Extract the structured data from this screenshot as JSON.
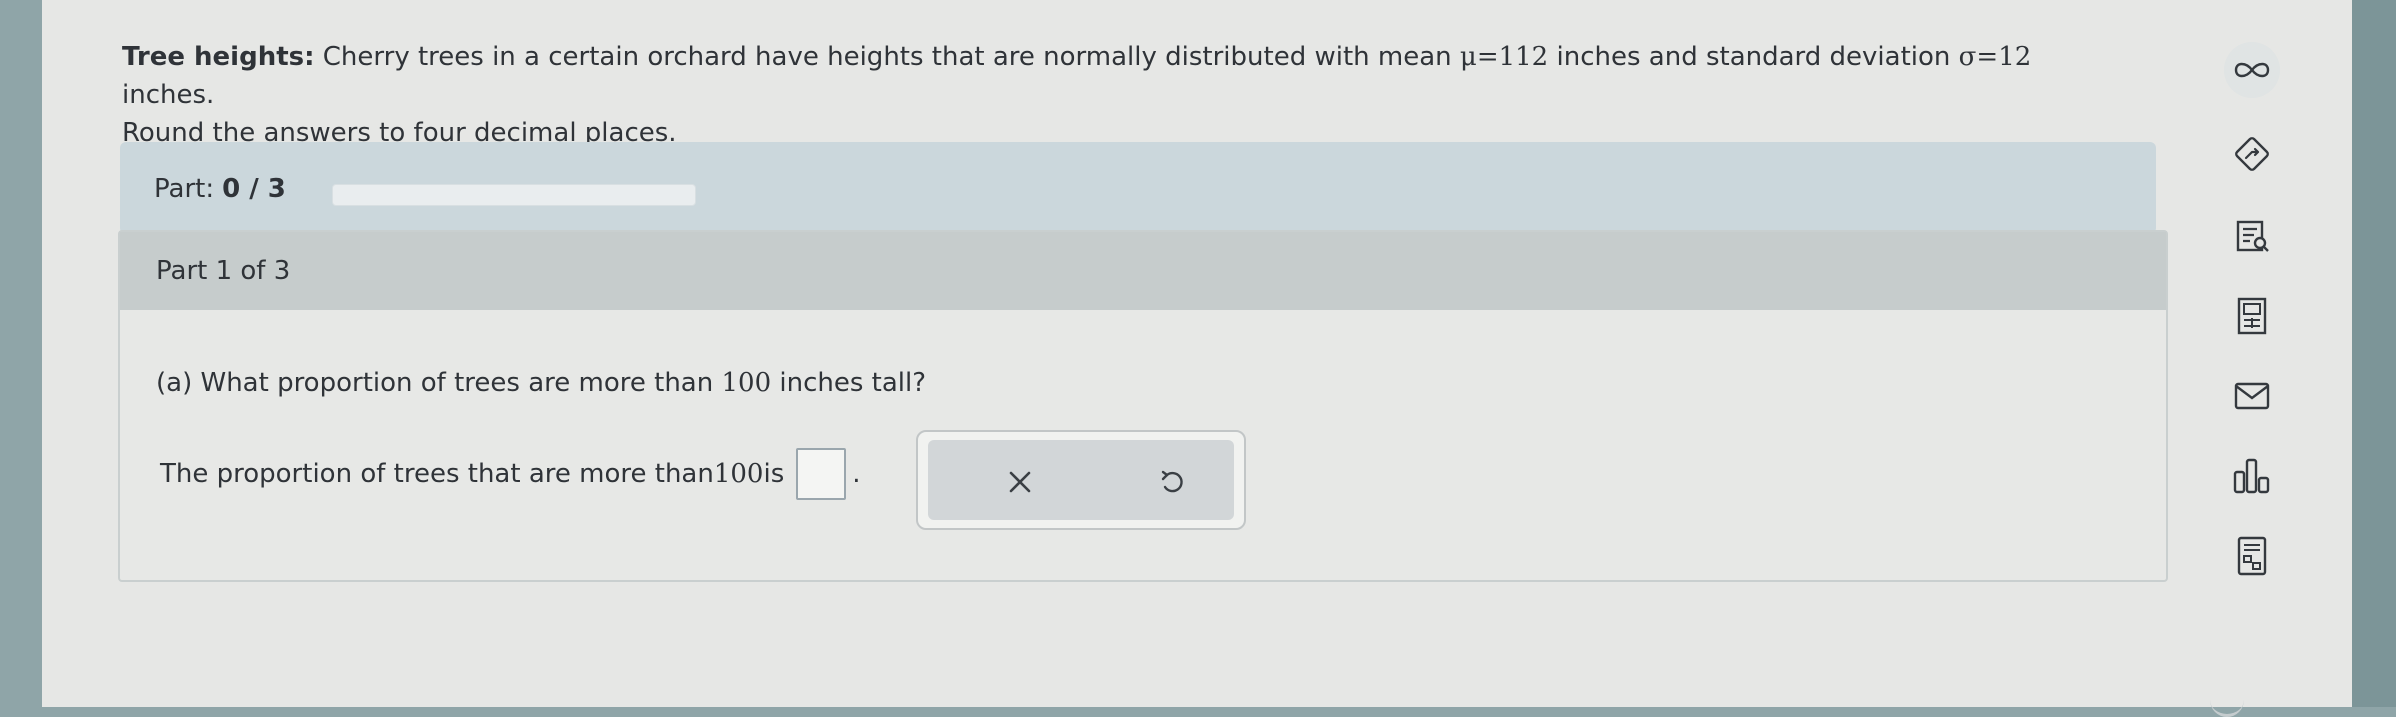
{
  "problem": {
    "title": "Tree heights:",
    "text_part1": "Cherry trees in a certain orchard have heights that are normally distributed with mean ",
    "mu_symbol": "μ",
    "mu_value": "=112",
    "text_part2": " inches and standard deviation ",
    "sigma_symbol": "σ",
    "sigma_value": "=12",
    "text_part3": " inches.",
    "instruction": "Round the answers to four decimal places."
  },
  "progress": {
    "label": "Part:",
    "value": "0 / 3",
    "fraction": 0
  },
  "part": {
    "header": "Part 1 of 3",
    "question_prefix": "(a) What proportion of trees are more than ",
    "question_number": "100",
    "question_suffix": " inches tall?",
    "answer_prefix": "The proportion of trees that are more than ",
    "answer_number": "100",
    "answer_is": " is",
    "answer_value": "",
    "answer_period": "."
  },
  "actions": {
    "clear_icon": "x-icon",
    "undo_icon": "undo-icon"
  },
  "side_tools": [
    {
      "icon": "infinity-icon"
    },
    {
      "icon": "compass-icon"
    },
    {
      "icon": "lookup-icon"
    },
    {
      "icon": "calculator-icon"
    },
    {
      "icon": "mail-icon"
    },
    {
      "icon": "bar-chart-icon"
    },
    {
      "icon": "data-table-icon"
    }
  ],
  "colors": {
    "accent": "#5f8fb0",
    "part_bar": "#cbd7dc",
    "header": "#c6cccc"
  }
}
